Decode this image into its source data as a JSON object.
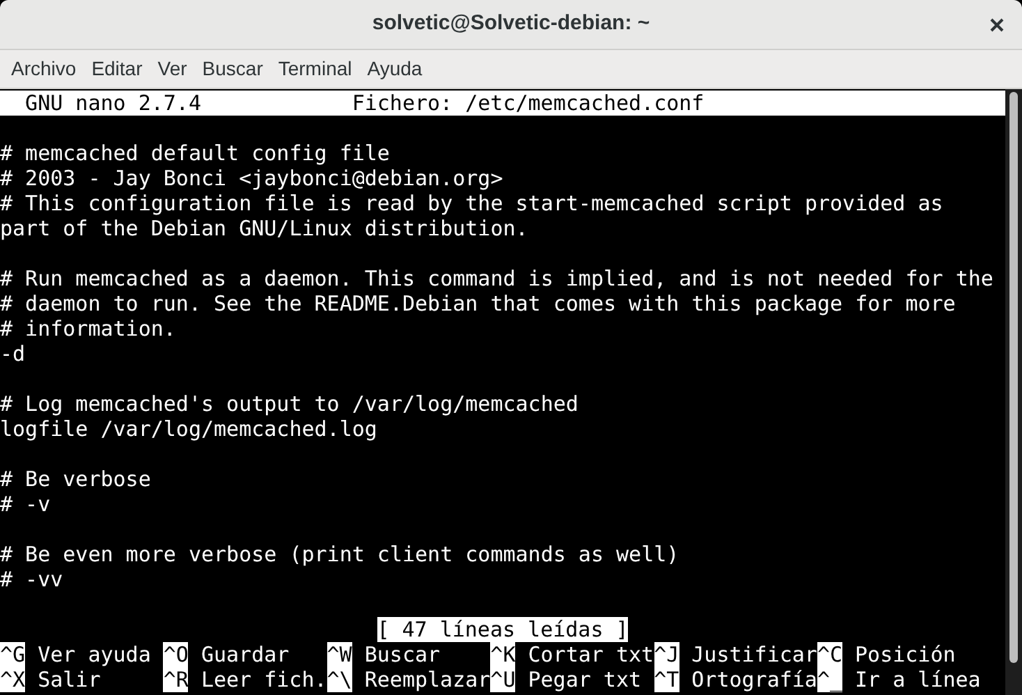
{
  "window": {
    "title": "solvetic@Solvetic-debian: ~"
  },
  "menu": [
    "Archivo",
    "Editar",
    "Ver",
    "Buscar",
    "Terminal",
    "Ayuda"
  ],
  "nano_header": {
    "version": "GNU nano 2.7.4",
    "file": "Fichero: /etc/memcached.conf"
  },
  "lines": [
    {
      "kind": "blank"
    },
    {
      "kind": "text",
      "text": "# memcached default config file"
    },
    {
      "kind": "text",
      "text": "# 2003 - Jay Bonci <jaybonci@debian.org>"
    },
    {
      "kind": "text",
      "text": "# This configuration file is read by the start-memcached script provided as"
    },
    {
      "kind": "text",
      "text": "part of the Debian GNU/Linux distribution."
    },
    {
      "kind": "blank"
    },
    {
      "kind": "text",
      "text": "# Run memcached as a daemon. This command is implied, and is not needed for the"
    },
    {
      "kind": "text",
      "text": "# daemon to run. See the README.Debian that comes with this package for more"
    },
    {
      "kind": "text",
      "text": "# information."
    },
    {
      "kind": "text",
      "text": "-d"
    },
    {
      "kind": "blank"
    },
    {
      "kind": "text",
      "text": "# Log memcached's output to /var/log/memcached"
    },
    {
      "kind": "text",
      "text": "logfile /var/log/memcached.log"
    },
    {
      "kind": "blank"
    },
    {
      "kind": "text",
      "text": "# Be verbose"
    },
    {
      "kind": "text",
      "text": "# -v"
    },
    {
      "kind": "blank"
    },
    {
      "kind": "text",
      "text": "# Be even more verbose (print client commands as well)"
    },
    {
      "kind": "text",
      "text": "# -vv"
    },
    {
      "kind": "blank"
    }
  ],
  "status": "[ 47 líneas leídas ]",
  "shortcuts": [
    [
      {
        "key": "^G",
        "label": "Ver ayuda"
      },
      {
        "key": "^O",
        "label": "Guardar"
      },
      {
        "key": "^W",
        "label": "Buscar"
      },
      {
        "key": "^K",
        "label": "Cortar txt"
      },
      {
        "key": "^J",
        "label": "Justificar"
      },
      {
        "key": "^C",
        "label": "Posición"
      }
    ],
    [
      {
        "key": "^X",
        "label": "Salir"
      },
      {
        "key": "^R",
        "label": "Leer fich."
      },
      {
        "key": "^\\",
        "label": "Reemplazar"
      },
      {
        "key": "^U",
        "label": "Pegar txt"
      },
      {
        "key": "^T",
        "label": "Ortografía"
      },
      {
        "key": "^_",
        "label": "Ir a línea"
      }
    ]
  ]
}
